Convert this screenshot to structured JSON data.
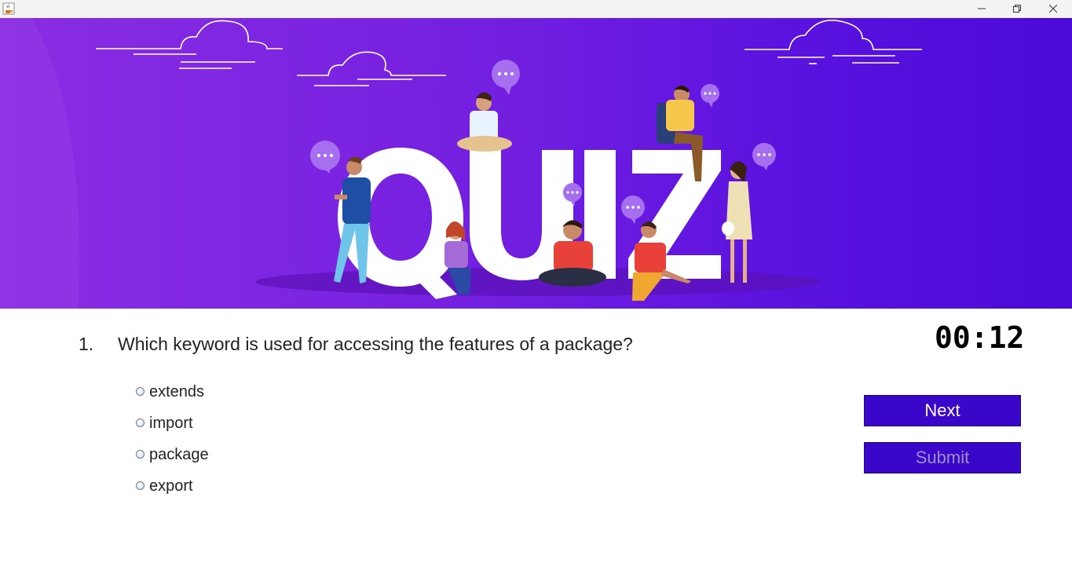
{
  "window": {
    "app_icon": "java-cup-icon",
    "controls": [
      "minimize-icon",
      "restore-icon",
      "close-icon"
    ]
  },
  "banner": {
    "word": "QUIZ",
    "colors": {
      "left": "#8a2de3",
      "right": "#4a0ad9"
    }
  },
  "question": {
    "number": "1.",
    "text": "Which keyword is used for accessing the features of a package?",
    "options": [
      "extends",
      "import",
      "package",
      "export"
    ]
  },
  "timer": "00:12",
  "buttons": {
    "next": "Next",
    "submit": "Submit"
  },
  "colors": {
    "button_bg": "#3a06c9",
    "submit_text_disabled": "#9d8fc7"
  }
}
